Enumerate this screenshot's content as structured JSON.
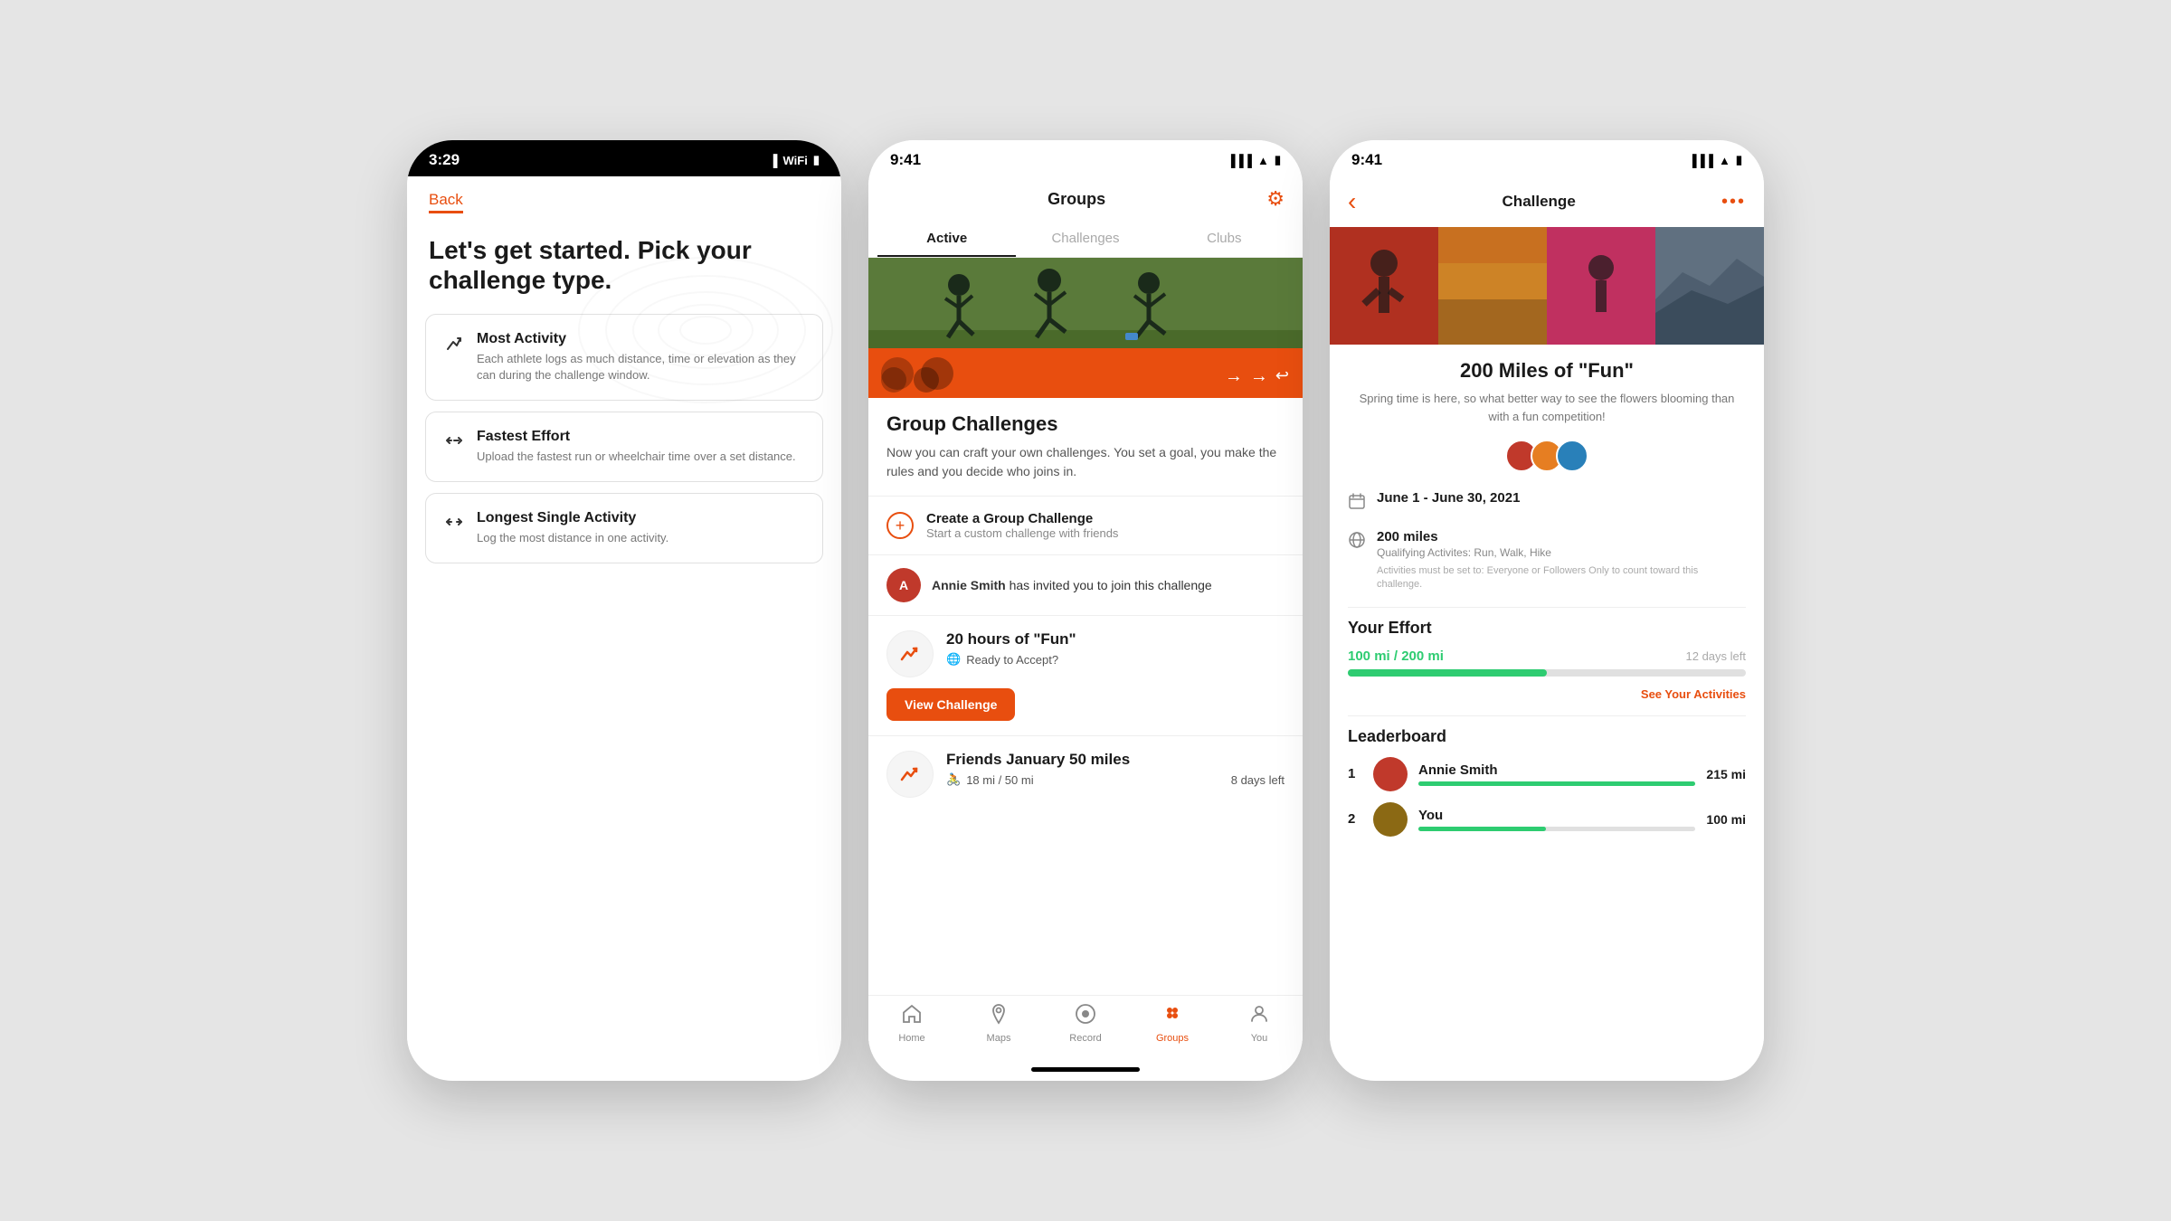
{
  "screen1": {
    "status_time": "3:29",
    "back_label": "Back",
    "title": "Let's get started. Pick your challenge type.",
    "options": [
      {
        "id": "most-activity",
        "icon": "↗",
        "title": "Most Activity",
        "description": "Each athlete logs as much distance, time or elevation as they can during the challenge window."
      },
      {
        "id": "fastest-effort",
        "icon": "⇌",
        "title": "Fastest Effort",
        "description": "Upload the fastest run or wheelchair time over a set distance."
      },
      {
        "id": "longest-single",
        "icon": "⇄",
        "title": "Longest Single Activity",
        "description": "Log the most distance in one activity."
      }
    ]
  },
  "screen2": {
    "status_time": "9:41",
    "title": "Groups",
    "gear_icon": "⚙",
    "tabs": [
      {
        "label": "Active",
        "active": false
      },
      {
        "label": "Challenges",
        "active": false
      },
      {
        "label": "Clubs",
        "active": false
      }
    ],
    "group_challenges": {
      "title": "Group Challenges",
      "description": "Now you can craft your own challenges. You set a goal, you make the rules and you decide who joins in."
    },
    "create_challenge": {
      "title": "Create a Group Challenge",
      "subtitle": "Start a custom challenge with friends"
    },
    "invite": {
      "name": "Annie Smith",
      "text": "Annie Smith has invited you to join this challenge"
    },
    "challenge1": {
      "name": "20 hours of \"Fun\"",
      "status": "Ready to Accept?",
      "view_btn": "View Challenge"
    },
    "challenge2": {
      "name": "Friends January 50 miles",
      "progress": "18 mi / 50 mi",
      "days_left": "8 days left"
    },
    "nav": {
      "items": [
        {
          "icon": "⌂",
          "label": "Home",
          "active": false
        },
        {
          "icon": "◎",
          "label": "Maps",
          "active": false
        },
        {
          "icon": "⊙",
          "label": "Record",
          "active": false
        },
        {
          "icon": "◉",
          "label": "Groups",
          "active": true
        },
        {
          "icon": "◎",
          "label": "You",
          "active": false
        }
      ]
    }
  },
  "screen3": {
    "status_time": "9:41",
    "title": "Challenge",
    "back_icon": "‹",
    "more_icon": "•••",
    "challenge": {
      "name": "200 Miles of \"Fun\"",
      "description": "Spring time is here, so what better way to see the flowers blooming than with a fun competition!",
      "date_range": "June 1 - June 30, 2021",
      "distance": "200 miles",
      "qualifying": "Qualifying Activites: Run, Walk, Hike",
      "visibility_note": "Activities must be set to: Everyone or Followers Only to count toward this challenge."
    },
    "your_effort": {
      "title": "Your Effort",
      "current": "100 mi",
      "total": "200 mi",
      "days_left": "12 days left",
      "progress_pct": 50,
      "see_activities": "See Your Activities"
    },
    "leaderboard": {
      "title": "Leaderboard",
      "entries": [
        {
          "rank": 1,
          "name": "Annie Smith",
          "miles": "215 mi",
          "bar_pct": 100
        },
        {
          "rank": 2,
          "name": "You",
          "miles": "100 mi",
          "bar_pct": 46
        }
      ]
    }
  }
}
